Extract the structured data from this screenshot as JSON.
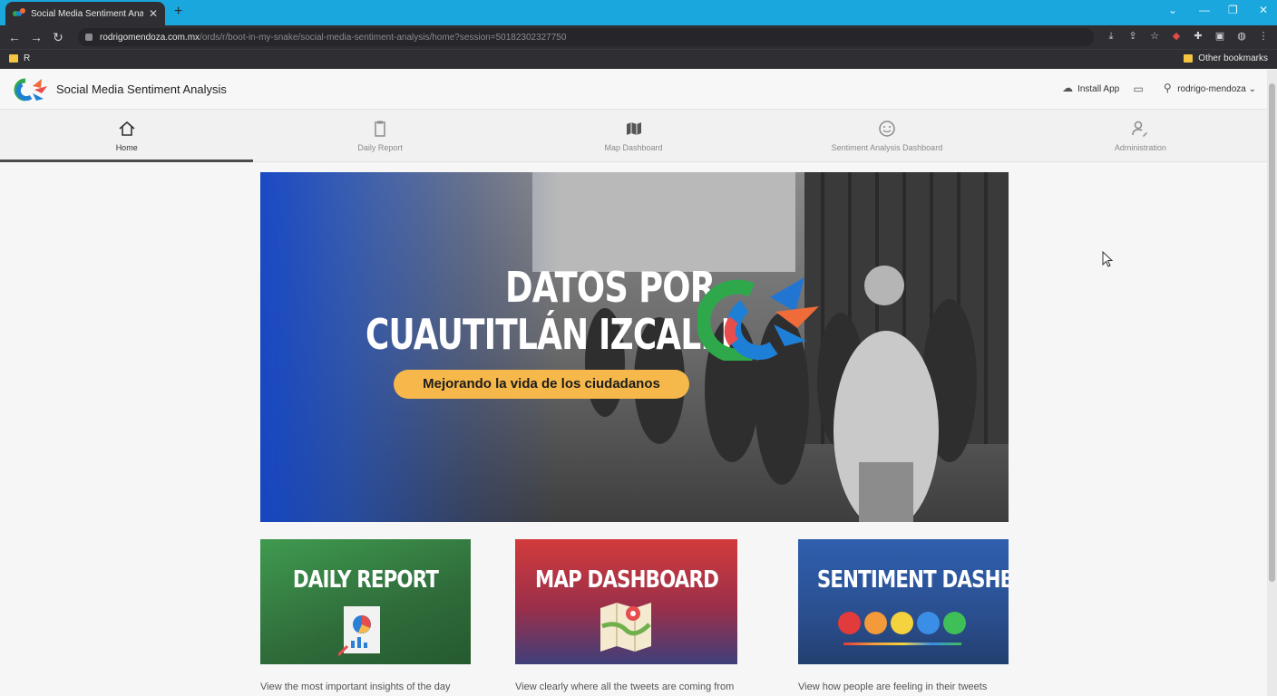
{
  "browser": {
    "tab_title": "Social Media Sentiment Analysis",
    "url_host": "rodrigomendoza.com.mx",
    "url_path": "/ords/r/boot-in-my-snake/social-media-sentiment-analysis/home?session=50182302327750",
    "bookmarks_left": "R",
    "bookmarks_right": "Other bookmarks"
  },
  "header": {
    "app_title": "Social Media Sentiment Analysis",
    "install_app": "Install App",
    "username": "rodrigo-mendoza"
  },
  "nav": {
    "tabs": [
      {
        "label": "Home",
        "icon": "home-icon",
        "active": true
      },
      {
        "label": "Daily Report",
        "icon": "clipboard-icon",
        "active": false
      },
      {
        "label": "Map Dashboard",
        "icon": "map-icon",
        "active": false
      },
      {
        "label": "Sentiment Analysis Dashboard",
        "icon": "smiley-icon",
        "active": false
      },
      {
        "label": "Administration",
        "icon": "user-settings-icon",
        "active": false
      }
    ]
  },
  "hero": {
    "line1": "DATOS POR",
    "line2": "CUAUTITLÁN IZCALLI",
    "tagline": "Mejorando la vida de los ciudadanos"
  },
  "cards": [
    {
      "title": "DAILY REPORT",
      "description": "View the most important insights of the day"
    },
    {
      "title": "MAP DASHBOARD",
      "description": "View clearly where all the tweets are coming from"
    },
    {
      "title": "SENTIMENT DASHBOARD",
      "description": "View how people are feeling in their tweets"
    }
  ],
  "colors": {
    "browser_accent": "#1aa7dd",
    "hero_pill": "#f6b84b",
    "daily_card": "#3f8a4a",
    "map_card": "#c33a3a",
    "sentiment_card": "#2e4f8f"
  }
}
